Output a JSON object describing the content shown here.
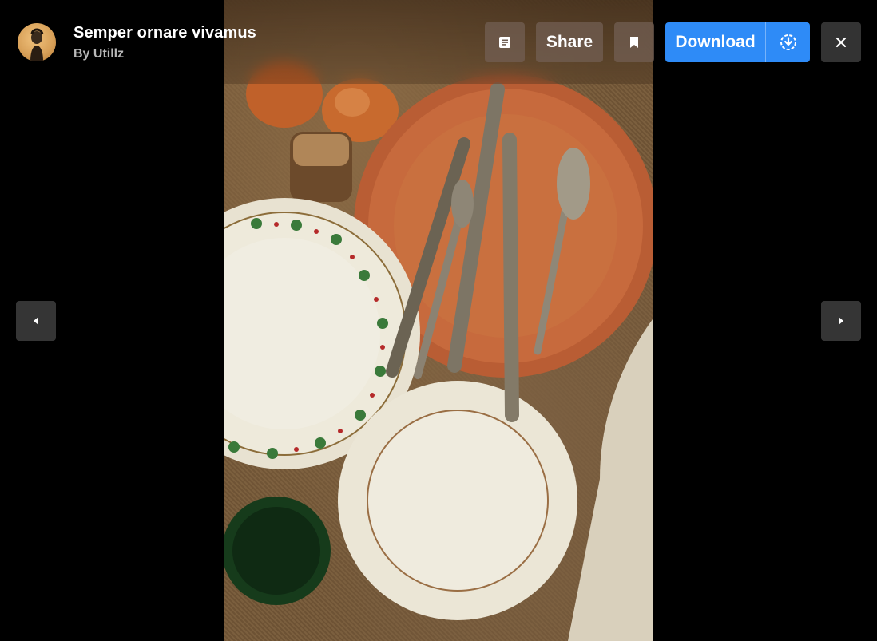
{
  "photo": {
    "title": "Semper ornare vivamus",
    "author_line": "By Utillz",
    "author_avatar": "avatar-icon"
  },
  "toolbar": {
    "details_icon": "details-icon",
    "share_label": "Share",
    "bookmark_icon": "bookmark-icon",
    "download_label": "Download",
    "download_options_icon": "download-circle-icon",
    "close_icon": "close-icon"
  },
  "navigation": {
    "prev_icon": "arrow-left-icon",
    "next_icon": "arrow-right-icon"
  },
  "colors": {
    "background": "#000000",
    "download_button": "#2e8bf7",
    "ghost_button": "#736054",
    "close_button": "#333333",
    "nav_button": "#353535"
  }
}
